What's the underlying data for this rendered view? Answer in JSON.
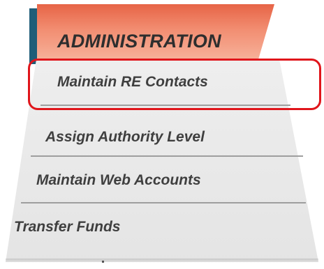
{
  "menu": {
    "header": "ADMINISTRATION",
    "items": [
      {
        "label": "Maintain RE Contacts",
        "highlighted": true
      },
      {
        "label": "Assign Authority Level",
        "highlighted": false
      },
      {
        "label": "Maintain Web Accounts",
        "highlighted": false
      },
      {
        "label": "Transfer Funds",
        "highlighted": false
      }
    ]
  },
  "colors": {
    "header_top": "#e76446",
    "header_bottom": "#f7b39c",
    "panel": "#eeeeee",
    "text": "#3f3f3f",
    "highlight_border": "#e0151b",
    "accent_strip": "#1f5d78"
  }
}
